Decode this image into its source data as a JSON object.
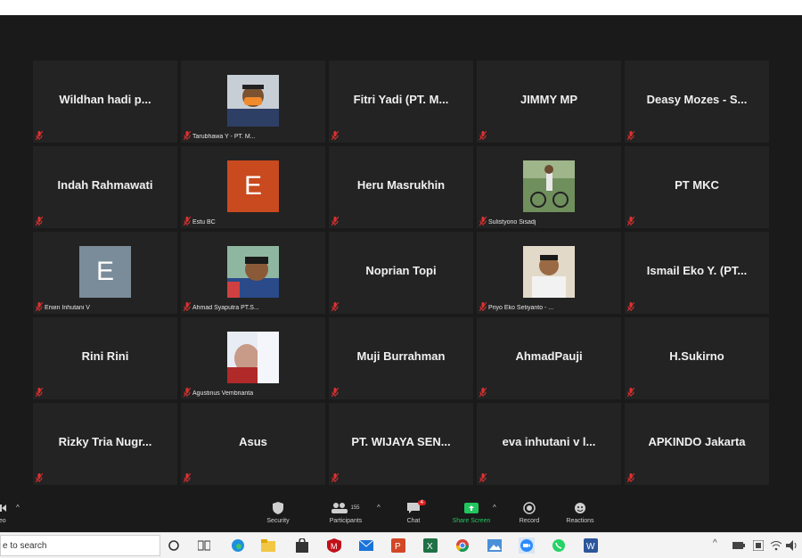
{
  "participants": [
    {
      "name": "Wildhan hadi p...",
      "type": "name"
    },
    {
      "name": "",
      "type": "photo",
      "label": "Tarubhawa Y - PT. M...",
      "photo": "masked"
    },
    {
      "name": "Fitri Yadi (PT. M...",
      "type": "name"
    },
    {
      "name": "JIMMY MP",
      "type": "name"
    },
    {
      "name": "Deasy Mozes - S...",
      "type": "name"
    },
    {
      "name": "Indah Rahmawati",
      "type": "name"
    },
    {
      "name": "",
      "type": "letter",
      "letter": "E",
      "label": "Estu BC",
      "bg": "#c94a1e"
    },
    {
      "name": "Heru Masrukhin",
      "type": "name"
    },
    {
      "name": "",
      "type": "photo",
      "label": "Sulistyono Sisadj",
      "photo": "bike"
    },
    {
      "name": "PT MKC",
      "type": "name"
    },
    {
      "name": "",
      "type": "letter",
      "letter": "E",
      "label": "Erwin Inhutani V",
      "bg": "#7a8c9a"
    },
    {
      "name": "",
      "type": "photo",
      "label": "Ahmad Syaputra PT.S...",
      "photo": "man"
    },
    {
      "name": "Noprian Topi",
      "type": "name"
    },
    {
      "name": "",
      "type": "photo",
      "label": "Priyo Eko Setiyanto - ...",
      "photo": "shirt"
    },
    {
      "name": "Ismail Eko Y. (PT...",
      "type": "name"
    },
    {
      "name": "Rini Rini",
      "type": "name"
    },
    {
      "name": "",
      "type": "photo",
      "label": "Agustinus Vembrianta",
      "photo": "blur"
    },
    {
      "name": "Muji Burrahman",
      "type": "name"
    },
    {
      "name": "AhmadPauji",
      "type": "name"
    },
    {
      "name": "H.Sukirno",
      "type": "name"
    },
    {
      "name": "Rizky Tria Nugr...",
      "type": "name"
    },
    {
      "name": "Asus",
      "type": "name"
    },
    {
      "name": "PT. WIJAYA SEN...",
      "type": "name"
    },
    {
      "name": "eva inhutani v l...",
      "type": "name"
    },
    {
      "name": "APKINDO Jakarta",
      "type": "name"
    }
  ],
  "toolbar": {
    "video_label": "ideo",
    "security_label": "Security",
    "participants_label": "Participants",
    "participants_count": "155",
    "chat_label": "Chat",
    "chat_badge": "4",
    "share_label": "Share Screen",
    "record_label": "Record",
    "reactions_label": "Reactions"
  },
  "taskbar": {
    "search_placeholder": "e to search"
  },
  "colors": {
    "background": "#1a1a1a",
    "tile": "#232323",
    "share_green": "#22c55e",
    "muted_red": "#e03030"
  }
}
